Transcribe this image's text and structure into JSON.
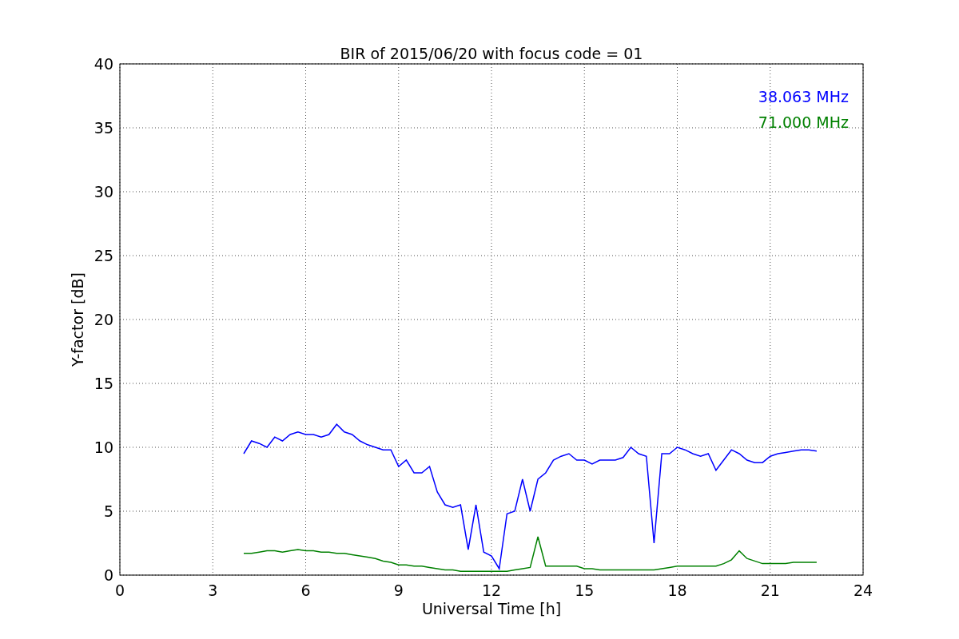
{
  "figure": {
    "chart_data": {
      "type": "line",
      "title": "BIR of 2015/06/20 with focus code = 01",
      "xlabel": "Universal Time [h]",
      "ylabel": "Y-factor [dB]",
      "x": [
        4,
        4.25,
        4.5,
        4.75,
        5,
        5.25,
        5.5,
        5.75,
        6,
        6.25,
        6.5,
        6.75,
        7,
        7.25,
        7.5,
        7.75,
        8,
        8.25,
        8.5,
        8.75,
        9,
        9.25,
        9.5,
        9.75,
        10,
        10.25,
        10.5,
        10.75,
        11,
        11.25,
        11.5,
        11.75,
        12,
        12.25,
        12.5,
        12.75,
        13,
        13.25,
        13.5,
        13.75,
        14,
        14.25,
        14.5,
        14.75,
        15,
        15.25,
        15.5,
        15.75,
        16,
        16.25,
        16.5,
        16.75,
        17,
        17.25,
        17.5,
        17.75,
        18,
        18.25,
        18.5,
        18.75,
        19,
        19.25,
        19.5,
        19.75,
        20,
        20.25,
        20.5,
        20.75,
        21,
        21.25,
        21.5,
        21.75,
        22,
        22.25,
        22.5
      ],
      "series": [
        {
          "name": "38.063 MHz",
          "color": "#0000ff",
          "values": [
            9.5,
            10.5,
            10.3,
            10,
            10.8,
            10.5,
            11,
            11.2,
            11,
            11,
            10.8,
            11,
            11.8,
            11.2,
            11,
            10.5,
            10.2,
            10,
            9.8,
            9.8,
            8.5,
            9,
            8,
            8,
            8.5,
            6.5,
            5.5,
            5.3,
            5.5,
            2,
            5.5,
            1.8,
            1.5,
            0.5,
            4.8,
            5,
            7.5,
            5,
            7.5,
            8,
            9,
            9.3,
            9.5,
            9,
            9,
            8.7,
            9,
            9,
            9,
            9.2,
            10,
            9.5,
            9.3,
            2.5,
            9.5,
            9.5,
            10,
            9.8,
            9.5,
            9.3,
            9.5,
            8.2,
            9,
            9.8,
            9.5,
            9,
            8.8,
            8.8,
            9.3,
            9.5,
            9.6,
            9.7,
            9.8,
            9.8,
            9.7
          ]
        },
        {
          "name": "71.000 MHz",
          "color": "#008000",
          "values": [
            1.7,
            1.7,
            1.8,
            1.9,
            1.9,
            1.8,
            1.9,
            2,
            1.9,
            1.9,
            1.8,
            1.8,
            1.7,
            1.7,
            1.6,
            1.5,
            1.4,
            1.3,
            1.1,
            1,
            0.8,
            0.8,
            0.7,
            0.7,
            0.6,
            0.5,
            0.4,
            0.4,
            0.3,
            0.3,
            0.3,
            0.3,
            0.3,
            0.3,
            0.3,
            0.4,
            0.5,
            0.6,
            3,
            0.7,
            0.7,
            0.7,
            0.7,
            0.7,
            0.5,
            0.5,
            0.4,
            0.4,
            0.4,
            0.4,
            0.4,
            0.4,
            0.4,
            0.4,
            0.5,
            0.6,
            0.7,
            0.7,
            0.7,
            0.7,
            0.7,
            0.7,
            0.9,
            1.2,
            1.9,
            1.3,
            1.1,
            0.9,
            0.9,
            0.9,
            0.9,
            1,
            1,
            1,
            1
          ]
        }
      ],
      "xlim": [
        0,
        24
      ],
      "ylim": [
        0,
        40
      ],
      "xticks": [
        0,
        3,
        6,
        9,
        12,
        15,
        18,
        21,
        24
      ],
      "yticks": [
        0,
        5,
        10,
        15,
        20,
        25,
        30,
        35,
        40
      ],
      "grid": true
    }
  }
}
